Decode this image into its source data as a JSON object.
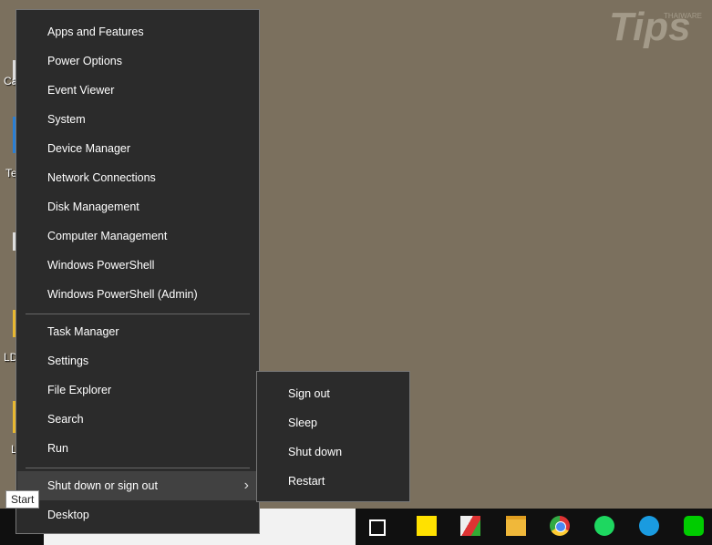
{
  "desktop": {
    "icons": [
      {
        "label": "Ca"
      },
      {
        "label": "Te"
      },
      {
        "label": ""
      },
      {
        "label": "LD"
      },
      {
        "label": "L"
      }
    ]
  },
  "logo": {
    "brand": "THAIWARE",
    "text": "Tips"
  },
  "menu": {
    "group1": [
      "Apps and Features",
      "Power Options",
      "Event Viewer",
      "System",
      "Device Manager",
      "Network Connections",
      "Disk Management",
      "Computer Management",
      "Windows PowerShell",
      "Windows PowerShell (Admin)"
    ],
    "group2": [
      "Task Manager",
      "Settings",
      "File Explorer",
      "Search",
      "Run"
    ],
    "shutdown": "Shut down or sign out",
    "desktop": "Desktop"
  },
  "submenu": [
    "Sign out",
    "Sleep",
    "Shut down",
    "Restart"
  ],
  "tooltip": "Start",
  "taskbar": {
    "apps": [
      "task-view",
      "sticky-notes",
      "app-red-green",
      "file-explorer",
      "chrome",
      "spotify",
      "skype",
      "line"
    ]
  },
  "colors": {
    "menu_bg": "#2b2b2b",
    "highlight": "#414141",
    "desktop": "#7b705e"
  }
}
